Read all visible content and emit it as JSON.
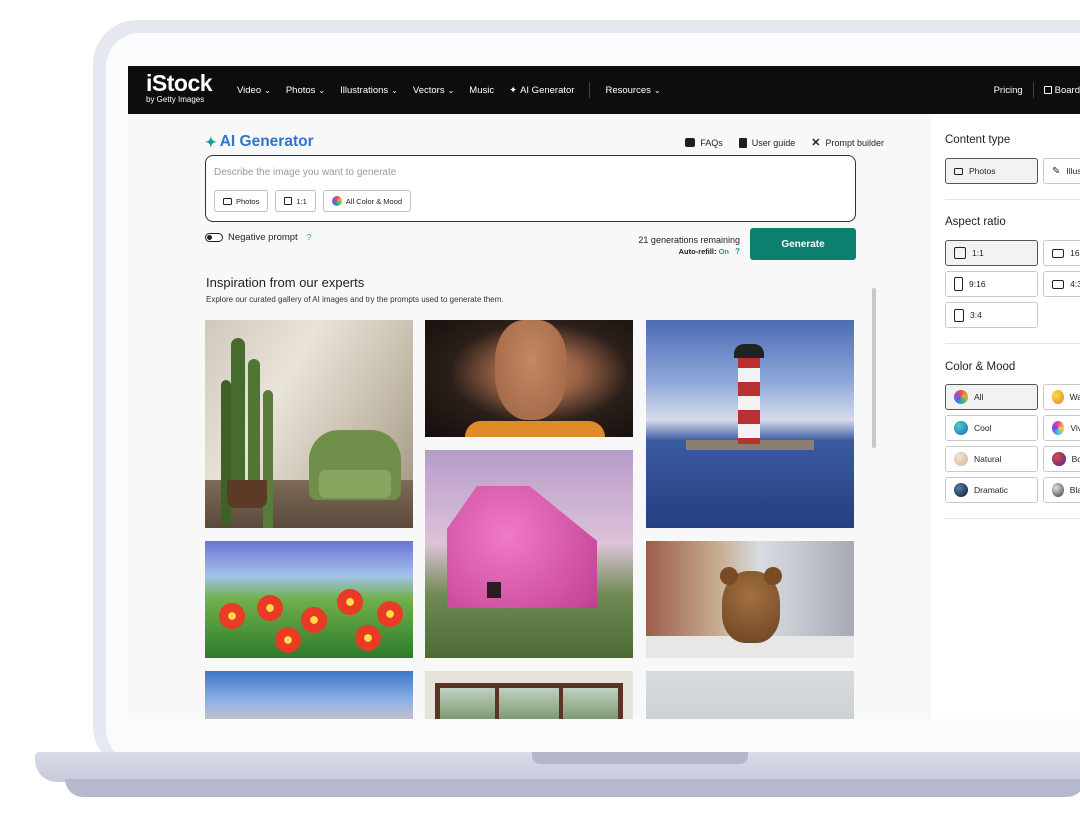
{
  "nav": {
    "logo": "iStock",
    "logo_sub": "by Getty Images",
    "links": [
      "Video",
      "Photos",
      "Illustrations",
      "Vectors",
      "Music",
      "AI Generator",
      "Resources"
    ],
    "right": [
      "Pricing",
      "Board"
    ]
  },
  "generator": {
    "title": "AI Generator",
    "help": [
      "FAQs",
      "User guide",
      "Prompt builder"
    ],
    "prompt_placeholder": "Describe the image you want to generate",
    "prompt_value": "",
    "chips": [
      "Photos",
      "1:1",
      "All Color & Mood"
    ],
    "negative_prompt_label": "Negative prompt",
    "help_mark": "?",
    "remaining": "21 generations remaining",
    "auto_refill_label": "Auto-refill:",
    "auto_refill_value": "On",
    "generate_label": "Generate"
  },
  "inspiration": {
    "title": "Inspiration from our experts",
    "subtitle": "Explore our curated gallery of AI images and try the prompts used to generate them."
  },
  "side": {
    "content_type_title": "Content type",
    "content_types": [
      "Photos",
      "Illus"
    ],
    "aspect_title": "Aspect ratio",
    "aspects": [
      "1:1",
      "16:",
      "9:16",
      "4:3",
      "3:4"
    ],
    "mood_title": "Color & Mood",
    "moods": [
      "All",
      "Wa",
      "Cool",
      "Viv",
      "Natural",
      "Bo",
      "Dramatic",
      "Bla"
    ]
  },
  "colors": {
    "accent": "#0d7f6e",
    "title_blue": "#2f74cf",
    "nav_bg": "#0c0d0d"
  }
}
